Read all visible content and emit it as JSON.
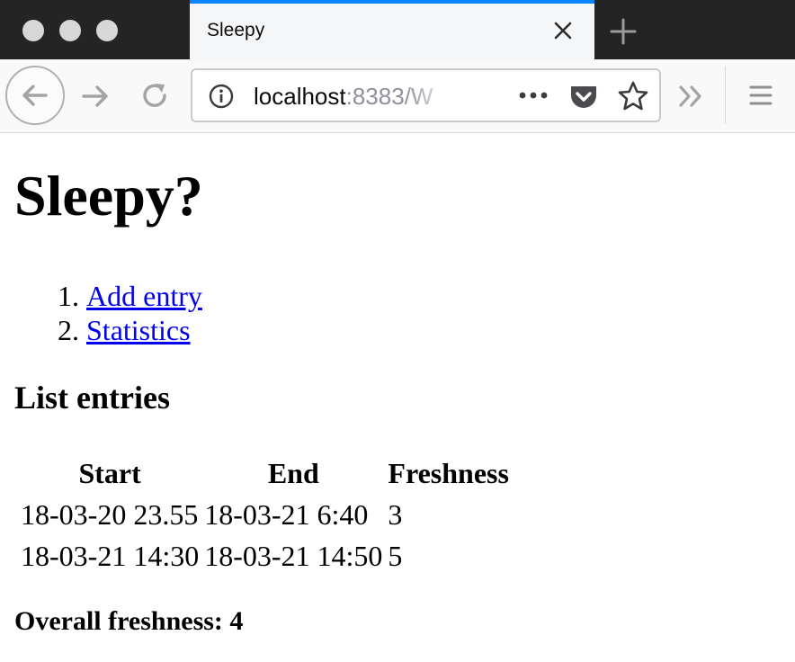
{
  "browser": {
    "tab_title": "Sleepy",
    "url_host": "localhost",
    "url_rest": ":8383/W",
    "accent_color": "#0a84ff",
    "icons": [
      "back-arrow-icon",
      "forward-arrow-icon",
      "reload-icon",
      "info-icon",
      "page-actions-icon",
      "pocket-icon",
      "star-icon",
      "overflow-chevron-icon",
      "menu-icon",
      "close-icon",
      "plus-icon"
    ]
  },
  "page": {
    "heading": "Sleepy?",
    "nav": [
      {
        "label": "Add entry"
      },
      {
        "label": "Statistics"
      }
    ],
    "section_title": "List entries",
    "table": {
      "headers": [
        "Start",
        "End",
        "Freshness"
      ],
      "rows": [
        [
          "18-03-20 23.55",
          "18-03-21 6:40",
          "3"
        ],
        [
          "18-03-21 14:30",
          "18-03-21 14:50",
          "5"
        ]
      ]
    },
    "overall_label": "Overall freshness: 4"
  }
}
